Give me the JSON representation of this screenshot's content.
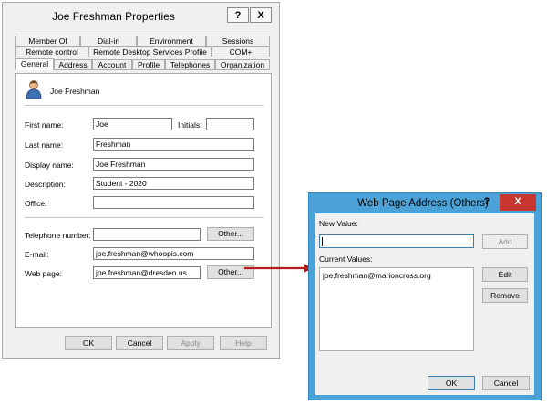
{
  "props": {
    "title": "Joe Freshman Properties",
    "help_glyph": "?",
    "close_glyph": "X",
    "tabs_row1": [
      "Member Of",
      "Dial-in",
      "Environment",
      "Sessions"
    ],
    "tabs_row2": [
      "Remote control",
      "Remote Desktop Services Profile",
      "COM+"
    ],
    "tabs_row3": [
      "General",
      "Address",
      "Account",
      "Profile",
      "Telephones",
      "Organization"
    ],
    "user_name": "Joe Freshman",
    "labels": {
      "first_name": "First name:",
      "initials": "Initials:",
      "last_name": "Last name:",
      "display_name": "Display name:",
      "description": "Description:",
      "office": "Office:",
      "telephone": "Telephone number:",
      "email": "E-mail:",
      "web_page": "Web page:"
    },
    "values": {
      "first_name": "Joe",
      "initials": "",
      "last_name": "Freshman",
      "display_name": "Joe Freshman",
      "description": "Student - 2020",
      "office": "",
      "telephone": "",
      "email": "joe.freshman@whoopis.com",
      "web_page": "joe.freshman@dresden.us"
    },
    "buttons": {
      "other_phone": "Other...",
      "other_web": "Other...",
      "ok": "OK",
      "cancel": "Cancel",
      "apply": "Apply",
      "help": "Help"
    }
  },
  "web_dialog": {
    "title": "Web Page Address (Others)",
    "help_glyph": "?",
    "close_glyph": "X",
    "new_value_label": "New Value:",
    "new_value": "",
    "add_button": "Add",
    "current_values_label": "Current Values:",
    "current_values": [
      "joe.freshman@marioncross.org"
    ],
    "edit_button": "Edit",
    "remove_button": "Remove",
    "ok_button": "OK",
    "cancel_button": "Cancel"
  },
  "colors": {
    "dialog_frame": "#4aa2d6",
    "close_red": "#c7372f",
    "arrow": "#b71c1c"
  }
}
